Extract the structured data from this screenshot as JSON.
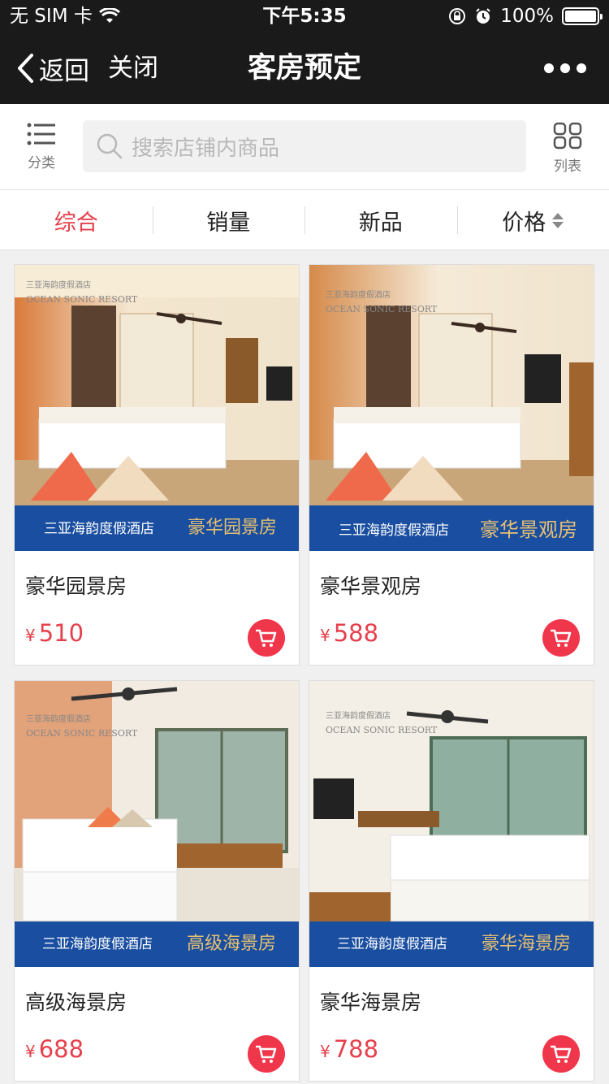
{
  "status_bar": {
    "carrier": "无 SIM 卡",
    "time": "下午5:35",
    "battery": "100%",
    "battery_level": 1.0
  },
  "nav": {
    "back_label": "返回",
    "close_label": "关闭",
    "title": "客房预定"
  },
  "search": {
    "category_label": "分类",
    "placeholder": "搜索店铺内商品",
    "list_label": "列表"
  },
  "sort": {
    "items": [
      {
        "label": "综合",
        "active": true
      },
      {
        "label": "销量",
        "active": false
      },
      {
        "label": "新品",
        "active": false
      },
      {
        "label": "价格",
        "active": false
      }
    ]
  },
  "colors": {
    "accent": "#e6404c",
    "cart": "#f0364a",
    "header_bg": "#1a1a1a",
    "banner_blue": "#1a4ea0",
    "banner_gold": "#e8c070"
  },
  "products": [
    {
      "name": "豪华园景房",
      "currency": "¥",
      "price": "510",
      "brand_cn": "三亚海韵度假酒店",
      "brand_en": "OCEAN SONIC RESORT",
      "banner_title": "豪华园景房"
    },
    {
      "name": "豪华景观房",
      "currency": "¥",
      "price": "588",
      "brand_cn": "三亚海韵度假酒店",
      "brand_en": "OCEAN SONIC RESORT",
      "banner_title": "豪华景观房"
    },
    {
      "name": "高级海景房",
      "currency": "¥",
      "price": "688",
      "brand_cn": "三亚海韵度假酒店",
      "brand_en": "OCEAN SONIC RESORT",
      "banner_title": "高级海景房"
    },
    {
      "name": "豪华海景房",
      "currency": "¥",
      "price": "788",
      "brand_cn": "三亚海韵度假酒店",
      "brand_en": "OCEAN SONIC RESORT",
      "banner_title": "豪华海景房"
    }
  ]
}
